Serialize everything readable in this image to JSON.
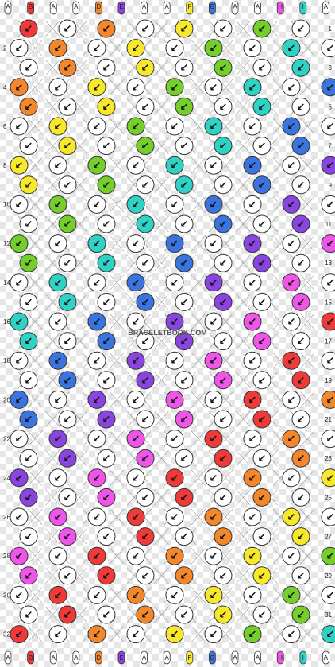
{
  "watermark": "BRACELETBOOK.COM",
  "rows": 32,
  "knots_per_row": 10,
  "knot_arrow": "↙",
  "string_labels": [
    "A",
    "B",
    "A",
    "A",
    "D",
    "E",
    "A",
    "A",
    "F",
    "G",
    "A",
    "A",
    "H",
    "I",
    "A"
  ],
  "colors": {
    "red": "#f03a3a",
    "orange": "#f4862b",
    "yellow": "#f7e92a",
    "green": "#74cf2a",
    "teal": "#2fd3c6",
    "blue": "#3a74e0",
    "purple": "#8a45e0",
    "pink": "#ee55e8",
    "white": "#ffffff",
    "outline": "#333333"
  },
  "string_colors": [
    "white",
    "red",
    "white",
    "white",
    "orange",
    "purple",
    "white",
    "white",
    "yellow",
    "blue",
    "white",
    "white",
    "pink",
    "teal",
    "white"
  ]
}
